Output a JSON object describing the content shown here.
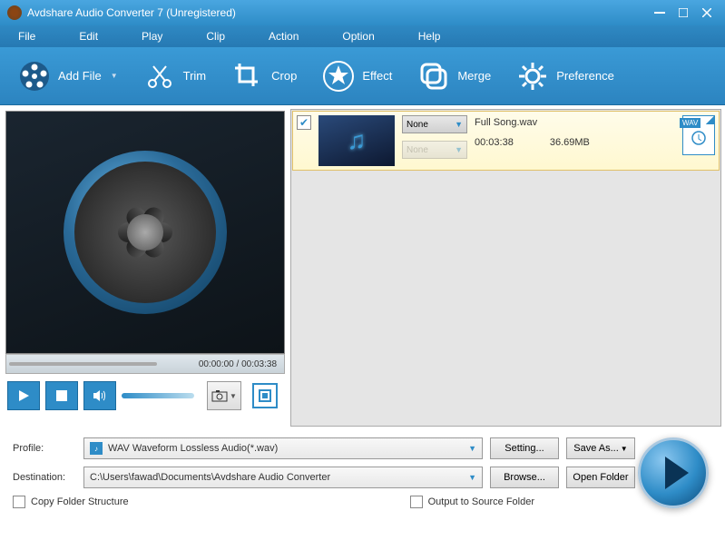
{
  "window": {
    "title": "Avdshare Audio Converter 7 (Unregistered)"
  },
  "menu": {
    "file": "File",
    "edit": "Edit",
    "play": "Play",
    "clip": "Clip",
    "action": "Action",
    "option": "Option",
    "help": "Help"
  },
  "toolbar": {
    "addfile": "Add File",
    "trim": "Trim",
    "crop": "Crop",
    "effect": "Effect",
    "merge": "Merge",
    "preference": "Preference"
  },
  "preview": {
    "time": "00:00:00 / 00:03:38"
  },
  "filelist": {
    "items": [
      {
        "name": "Full Song.wav",
        "duration": "00:03:38",
        "size": "36.69MB",
        "format": "WAV",
        "profile1": "None",
        "profile2": "None",
        "checked": true
      }
    ]
  },
  "profile": {
    "label": "Profile:",
    "value": "WAV Waveform Lossless Audio(*.wav)",
    "setting": "Setting...",
    "saveas": "Save As..."
  },
  "destination": {
    "label": "Destination:",
    "value": "C:\\Users\\fawad\\Documents\\Avdshare Audio Converter",
    "browse": "Browse...",
    "open": "Open Folder"
  },
  "options": {
    "copyfolder": "Copy Folder Structure",
    "outputsrc": "Output to Source Folder"
  }
}
